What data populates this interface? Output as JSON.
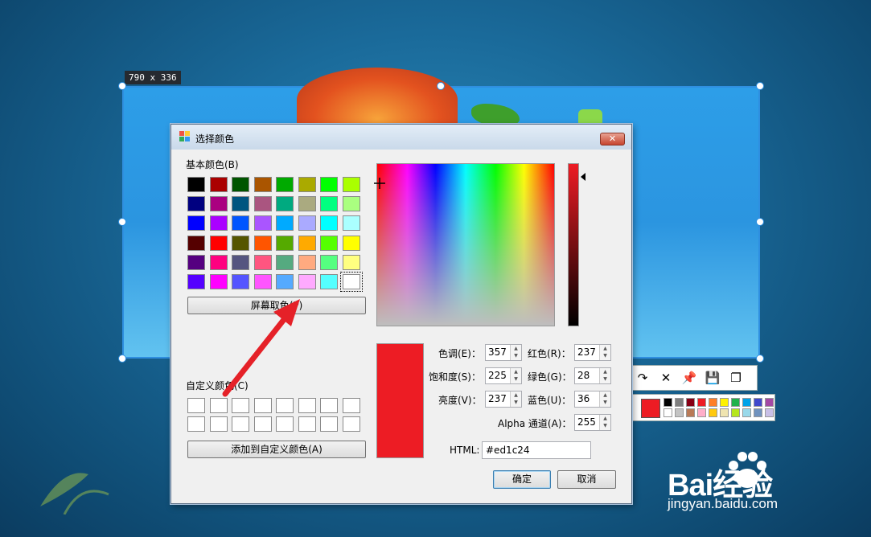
{
  "capture": {
    "size_label": "790 x 336"
  },
  "dialog": {
    "title": "选择颜色",
    "close_glyph": "✕",
    "basic_colors_label": "基本颜色(B)",
    "basic_colors": [
      [
        "#000000",
        "#aa0000",
        "#005500",
        "#aa5500",
        "#00aa00",
        "#aaaa00",
        "#00ff00",
        "#aaff00"
      ],
      [
        "#000080",
        "#aa0080",
        "#005580",
        "#aa5580",
        "#00aa80",
        "#aaaa80",
        "#00ff80",
        "#aaff80"
      ],
      [
        "#0000ff",
        "#aa00ff",
        "#0055ff",
        "#aa55ff",
        "#00aaff",
        "#aaaaff",
        "#00ffff",
        "#aaffff"
      ],
      [
        "#550000",
        "#ff0000",
        "#555500",
        "#ff5500",
        "#55aa00",
        "#ffaa00",
        "#55ff00",
        "#ffff00"
      ],
      [
        "#550080",
        "#ff0080",
        "#555580",
        "#ff5580",
        "#55aa80",
        "#ffaa80",
        "#55ff80",
        "#ffff80"
      ],
      [
        "#5500ff",
        "#ff00ff",
        "#5555ff",
        "#ff55ff",
        "#55aaff",
        "#ffaaff",
        "#55ffff",
        "#ffffff"
      ]
    ],
    "screen_pick_label": "屏幕取色(P)",
    "custom_colors_label": "自定义颜色(C)",
    "add_custom_label": "添加到自定义颜色(A)",
    "fields": {
      "hue": {
        "label": "色调(E)：",
        "value": "357"
      },
      "sat": {
        "label": "饱和度(S)：",
        "value": "225"
      },
      "lum": {
        "label": "亮度(V)：",
        "value": "237"
      },
      "red": {
        "label": "红色(R)：",
        "value": "237"
      },
      "green": {
        "label": "绿色(G)：",
        "value": "28"
      },
      "blue": {
        "label": "蓝色(U)：",
        "value": "36"
      },
      "alpha": {
        "label": "Alpha 通道(A)：",
        "value": "255"
      }
    },
    "html_label": "HTML:",
    "html_value": "#ed1c24",
    "ok_label": "确定",
    "cancel_label": "取消",
    "current_color": "#ed1c24"
  },
  "toolbar": {
    "redo_glyph": "↷",
    "close_glyph": "✕",
    "pin_glyph": "📌",
    "save_glyph": "💾",
    "copy_glyph": "❐",
    "palette_top": [
      "#000000",
      "#7f7f7f",
      "#880015",
      "#ed1c24",
      "#ff7f27",
      "#fff200",
      "#22b14c",
      "#00a2e8",
      "#3f48cc",
      "#a349a4"
    ],
    "palette_bottom": [
      "#ffffff",
      "#c3c3c3",
      "#b97a57",
      "#ffaec9",
      "#ffc90e",
      "#efe4b0",
      "#b5e61d",
      "#99d9ea",
      "#7092be",
      "#c8bfe7"
    ]
  },
  "watermark": {
    "brand": "Bai经验",
    "url": "jingyan.baidu.com"
  }
}
